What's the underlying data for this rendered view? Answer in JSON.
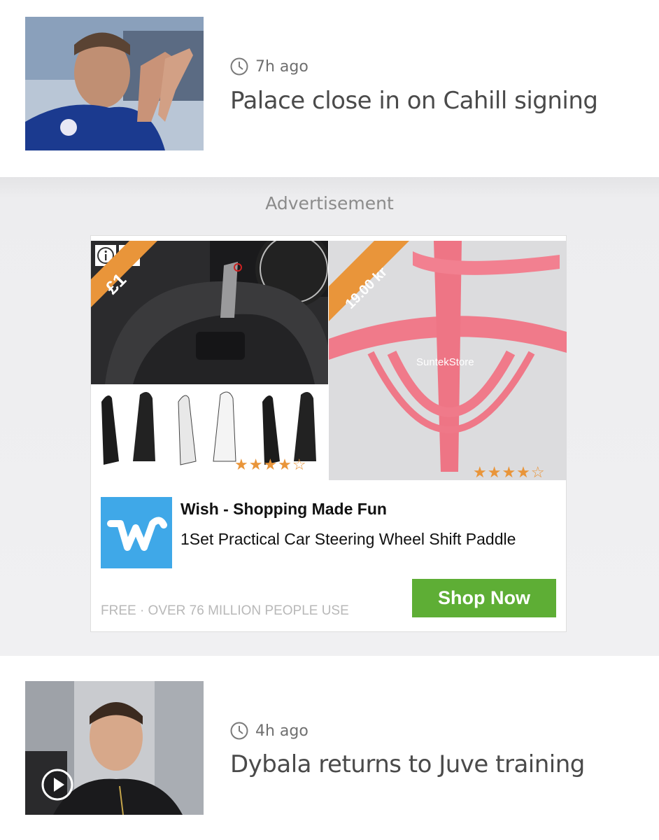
{
  "articles": [
    {
      "time": "7h ago",
      "headline": "Palace close in on Cahill signing",
      "has_video": false
    },
    {
      "time": "4h ago",
      "headline": "Dybala returns to Juve training",
      "has_video": true
    }
  ],
  "ad": {
    "label": "Advertisement",
    "price_tag_left": "£1",
    "price_tag_right": "19.00 kr",
    "image_watermark": "SuntekStore",
    "rating_left": 4.5,
    "rating_right": 4.5,
    "brand": "Wish - Shopping Made Fun",
    "product": "1Set Practical Car Steering Wheel Shift Paddle",
    "footer": "FREE · OVER 76 MILLION PEOPLE USE",
    "cta": "Shop Now"
  },
  "colors": {
    "cta": "#5eae35",
    "brand_logo": "#3fa8e8",
    "price_tag": "#e9953a",
    "text_primary": "#4a4a4a",
    "text_meta": "#6f6f6f"
  }
}
